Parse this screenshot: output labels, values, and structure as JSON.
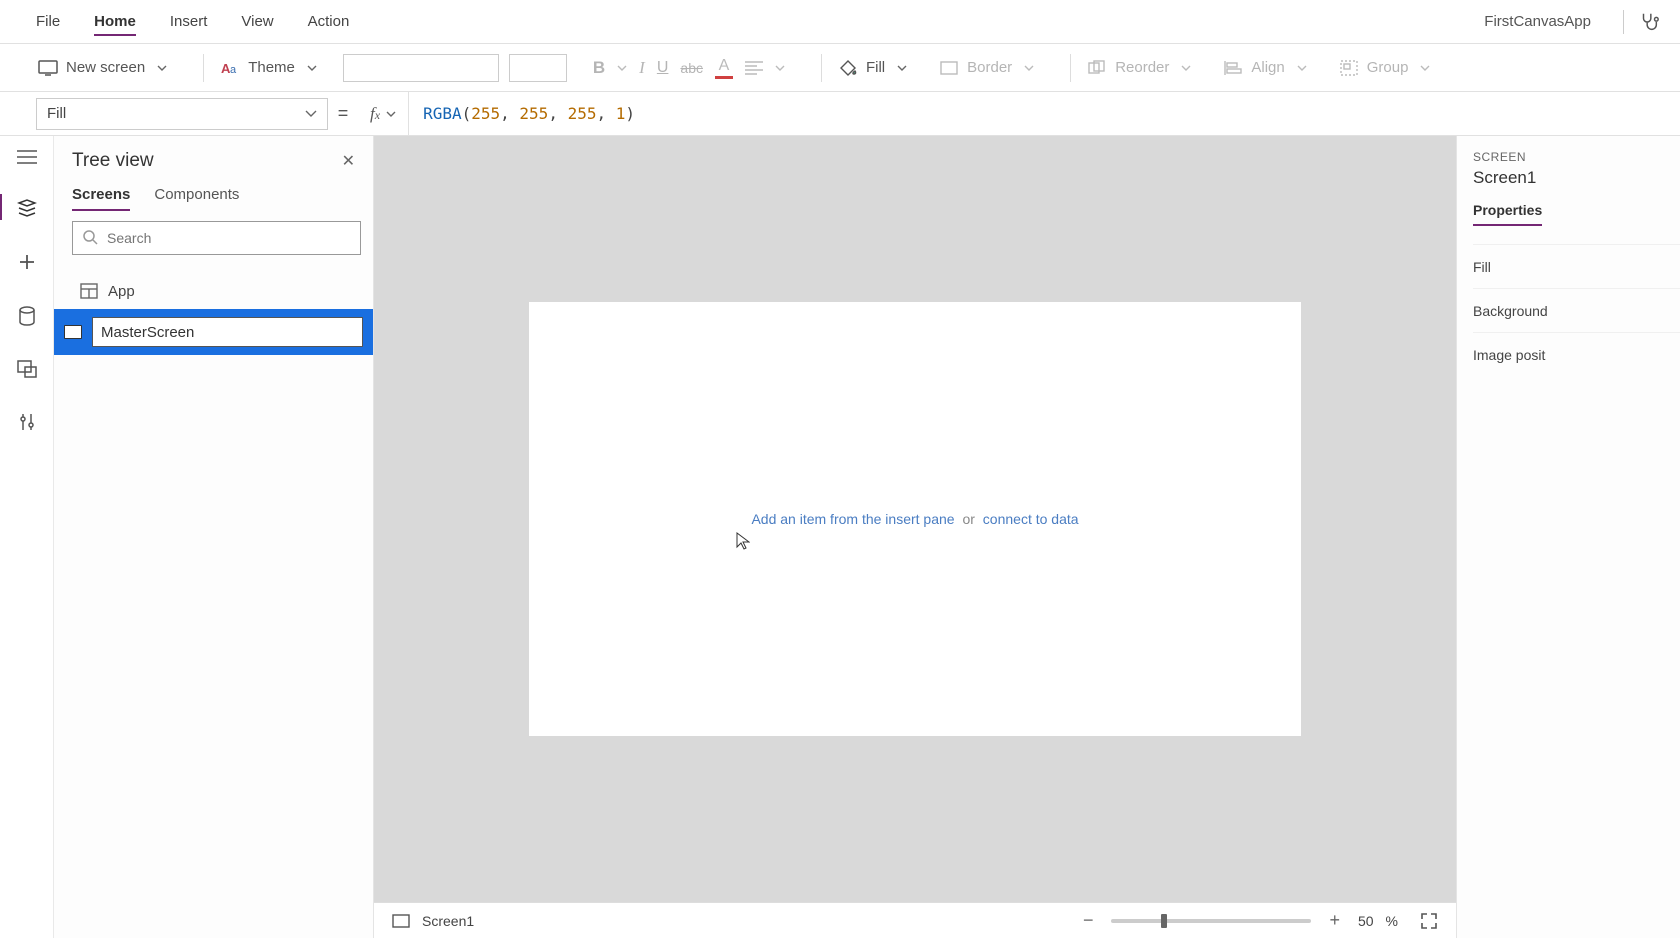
{
  "menu": {
    "items": [
      "File",
      "Home",
      "Insert",
      "View",
      "Action"
    ],
    "activeIndex": 1,
    "appName": "FirstCanvasApp"
  },
  "ribbon": {
    "newScreen": "New screen",
    "theme": "Theme",
    "fill": "Fill",
    "border": "Border",
    "reorder": "Reorder",
    "align": "Align",
    "group": "Group"
  },
  "formula": {
    "propertyName": "Fill",
    "fn": "RGBA",
    "args": [
      "255",
      "255",
      "255",
      "1"
    ]
  },
  "tree": {
    "title": "Tree view",
    "tabs": {
      "screens": "Screens",
      "components": "Components"
    },
    "searchPlaceholder": "Search",
    "appNode": "App",
    "renameValue": "MasterScreen"
  },
  "canvas": {
    "link1": "Add an item from the insert pane",
    "mid": "or",
    "link2": "connect to data"
  },
  "status": {
    "screenLabel": "Screen1",
    "zoomText": "50",
    "zoomPct": "%"
  },
  "props": {
    "sectionLabel": "SCREEN",
    "screenName": "Screen1",
    "tab": "Properties",
    "rows": {
      "fill": "Fill",
      "bg": "Background",
      "imgpos": "Image posit"
    }
  }
}
